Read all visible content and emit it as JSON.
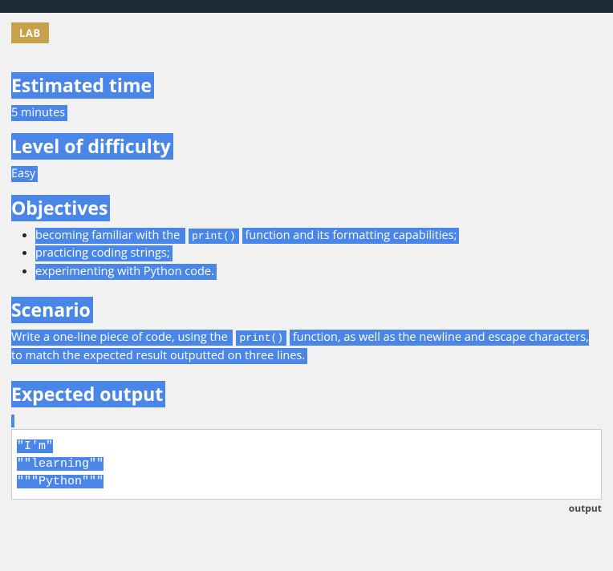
{
  "badge": "LAB",
  "sections": {
    "estimated_time": {
      "heading": "Estimated time",
      "value": "5 minutes"
    },
    "difficulty": {
      "heading": "Level of difficulty",
      "value": "Easy"
    },
    "objectives": {
      "heading": "Objectives",
      "items": [
        {
          "pre": "becoming familiar with the ",
          "code": "print()",
          "post": " function and its formatting capabilities;"
        },
        {
          "text": "practicing coding strings;"
        },
        {
          "text": "experimenting with Python code."
        }
      ]
    },
    "scenario": {
      "heading": "Scenario",
      "pre": "Write a one-line piece of code, using the ",
      "code": "print()",
      "post": " function, as well as the newline and escape characters, to match the expected result outputted on three lines."
    },
    "expected": {
      "heading": "Expected output",
      "lines": [
        "\"I'm\"",
        "\"\"learning\"\"",
        "\"\"\"Python\"\"\""
      ],
      "label": "output"
    }
  }
}
